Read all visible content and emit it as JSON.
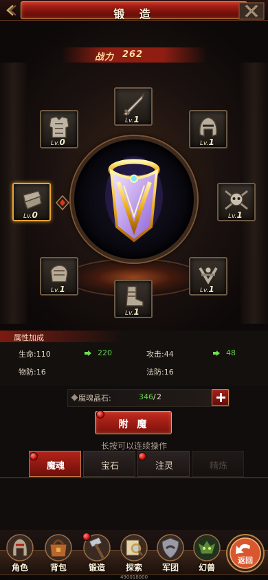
{
  "header": {
    "title": "锻 造"
  },
  "power": {
    "label": "战力",
    "value": "262"
  },
  "slots": [
    {
      "name": "weapon",
      "level_prefix": "Lv.",
      "level": "1"
    },
    {
      "name": "armor",
      "level_prefix": "Lv.",
      "level": "0"
    },
    {
      "name": "helmet",
      "level_prefix": "Lv.",
      "level": "1"
    },
    {
      "name": "bracer",
      "level_prefix": "Lv.",
      "level": "0"
    },
    {
      "name": "necklace",
      "level_prefix": "Lv.",
      "level": "1"
    },
    {
      "name": "glove",
      "level_prefix": "Lv.",
      "level": "1"
    },
    {
      "name": "ring",
      "level_prefix": "Lv.",
      "level": "1"
    },
    {
      "name": "boots",
      "level_prefix": "Lv.",
      "level": "1"
    }
  ],
  "attributes": {
    "title": "属性加成",
    "hp_label": "生命:110",
    "hp_next": "220",
    "atk_label": "攻击:44",
    "atk_next": "48",
    "pdef_label": "物防:16",
    "mdef_label": "法防:16"
  },
  "material": {
    "label": "魔魂晶石:",
    "have": "346",
    "separator": "/",
    "need": "2"
  },
  "enchant": {
    "button_label": "附 魔",
    "hint": "长按可以连续操作"
  },
  "tabs": [
    {
      "label": "魔魂",
      "state": "active"
    },
    {
      "label": "宝石",
      "state": "normal"
    },
    {
      "label": "注灵",
      "state": "normal"
    },
    {
      "label": "精炼",
      "state": "disabled"
    }
  ],
  "nav": [
    {
      "label": "角色",
      "icon": "helmet-icon"
    },
    {
      "label": "背包",
      "icon": "bag-icon"
    },
    {
      "label": "锻造",
      "icon": "hammer-icon"
    },
    {
      "label": "探索",
      "icon": "magnifier-icon"
    },
    {
      "label": "军团",
      "icon": "shield-icon"
    },
    {
      "label": "幻兽",
      "icon": "beast-icon"
    }
  ],
  "return_label": "返回",
  "exp_text": "490018000",
  "colors": {
    "accent_red": "#b2231a",
    "gold": "#e7a432",
    "green": "#5fd14a"
  }
}
